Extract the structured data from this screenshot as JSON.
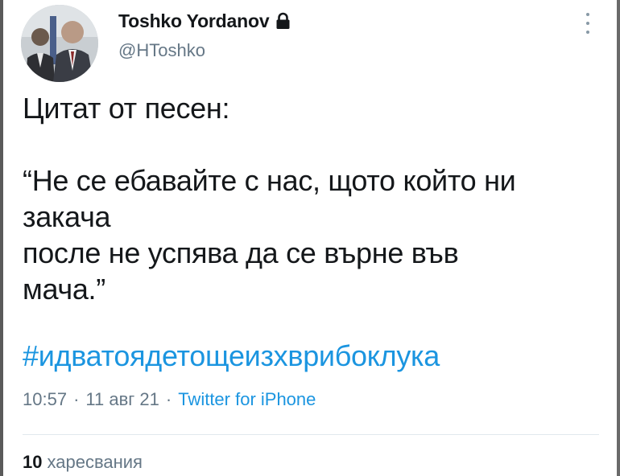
{
  "author": {
    "display_name": "Toshko Yordanov",
    "handle": "@HToshko",
    "protected_icon": "lock-icon",
    "avatar_icon": "profile-photo"
  },
  "tweet": {
    "lines": [
      "Цитат от песен:",
      "",
      "“Не се ебавайте с нас, щото който ни",
      "закача",
      "после не успява да се върне във",
      "мача.”"
    ],
    "hashtag": "#идватоядетощеизхврибоклука"
  },
  "meta": {
    "time": "10:57",
    "date": "11 авг 21",
    "separator": "·",
    "source": "Twitter for iPhone"
  },
  "stats": {
    "likes_count": "10",
    "likes_label": "харесвания"
  },
  "menu": {
    "more_icon": "more-vertical-icon"
  }
}
